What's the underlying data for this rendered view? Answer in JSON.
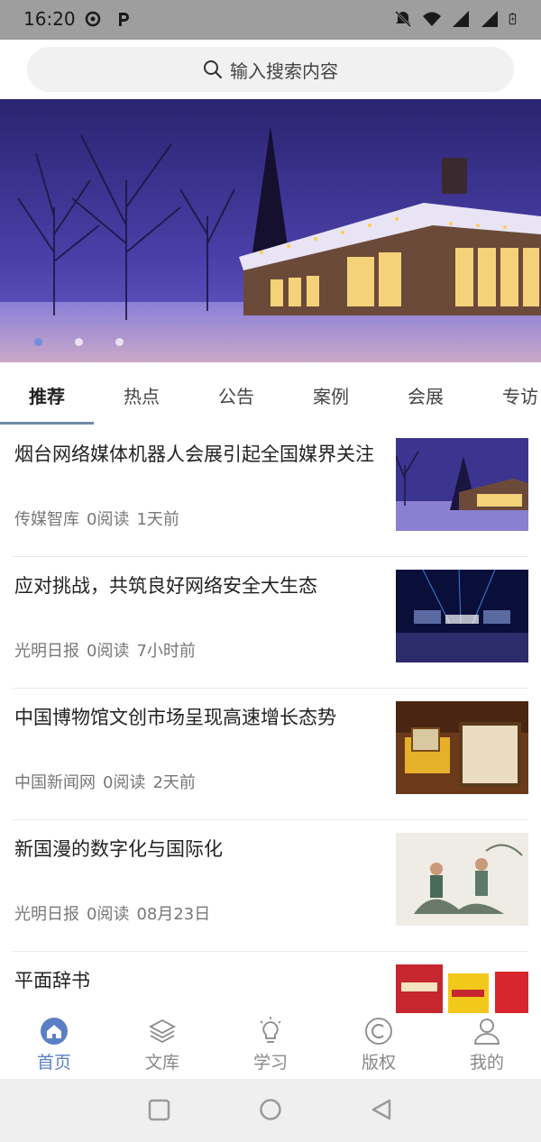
{
  "status_bar": {
    "time": "16:20",
    "left_icons": [
      "sync-app-icon",
      "p-app-icon"
    ],
    "right_icons": [
      "bell-muted-icon",
      "wifi-icon",
      "signal-icon",
      "signal-icon",
      "battery-icon"
    ]
  },
  "search": {
    "placeholder": "输入搜索内容",
    "icon": "search-icon"
  },
  "banner": {
    "dots_count": 3,
    "active_index": 0
  },
  "tabs": [
    {
      "label": "推荐",
      "active": true
    },
    {
      "label": "热点"
    },
    {
      "label": "公告"
    },
    {
      "label": "案例"
    },
    {
      "label": "会展"
    },
    {
      "label": "专访"
    }
  ],
  "news": [
    {
      "title": "烟台网络媒体机器人会展引起全国媒界关注",
      "source": "传媒智库",
      "reads": "0阅读",
      "time": "1天前",
      "thumb": "snowy-house-night"
    },
    {
      "title": "应对挑战，共筑良好网络安全大生态",
      "source": "光明日报",
      "reads": "0阅读",
      "time": "7小时前",
      "thumb": "conference-stage"
    },
    {
      "title": "中国博物馆文创市场呈现高速增长态势",
      "source": "中国新闻网",
      "reads": "0阅读",
      "time": "2天前",
      "thumb": "museum-crafts"
    },
    {
      "title": "新国漫的数字化与国际化",
      "source": "光明日报",
      "reads": "0阅读",
      "time": "08月23日",
      "thumb": "ink-painting"
    },
    {
      "title": "平面辞书",
      "source": "",
      "reads": "",
      "time": "",
      "thumb": "dictionary-books"
    }
  ],
  "bottom_nav": [
    {
      "label": "首页",
      "icon": "home-icon",
      "active": true
    },
    {
      "label": "文库",
      "icon": "layers-icon"
    },
    {
      "label": "学习",
      "icon": "lightbulb-icon"
    },
    {
      "label": "版权",
      "icon": "copyright-icon"
    },
    {
      "label": "我的",
      "icon": "user-icon"
    }
  ],
  "colors": {
    "accent": "#5b7fc4",
    "tab_underline": "#6e8aa6",
    "status_bar": "#9e9e9e"
  }
}
